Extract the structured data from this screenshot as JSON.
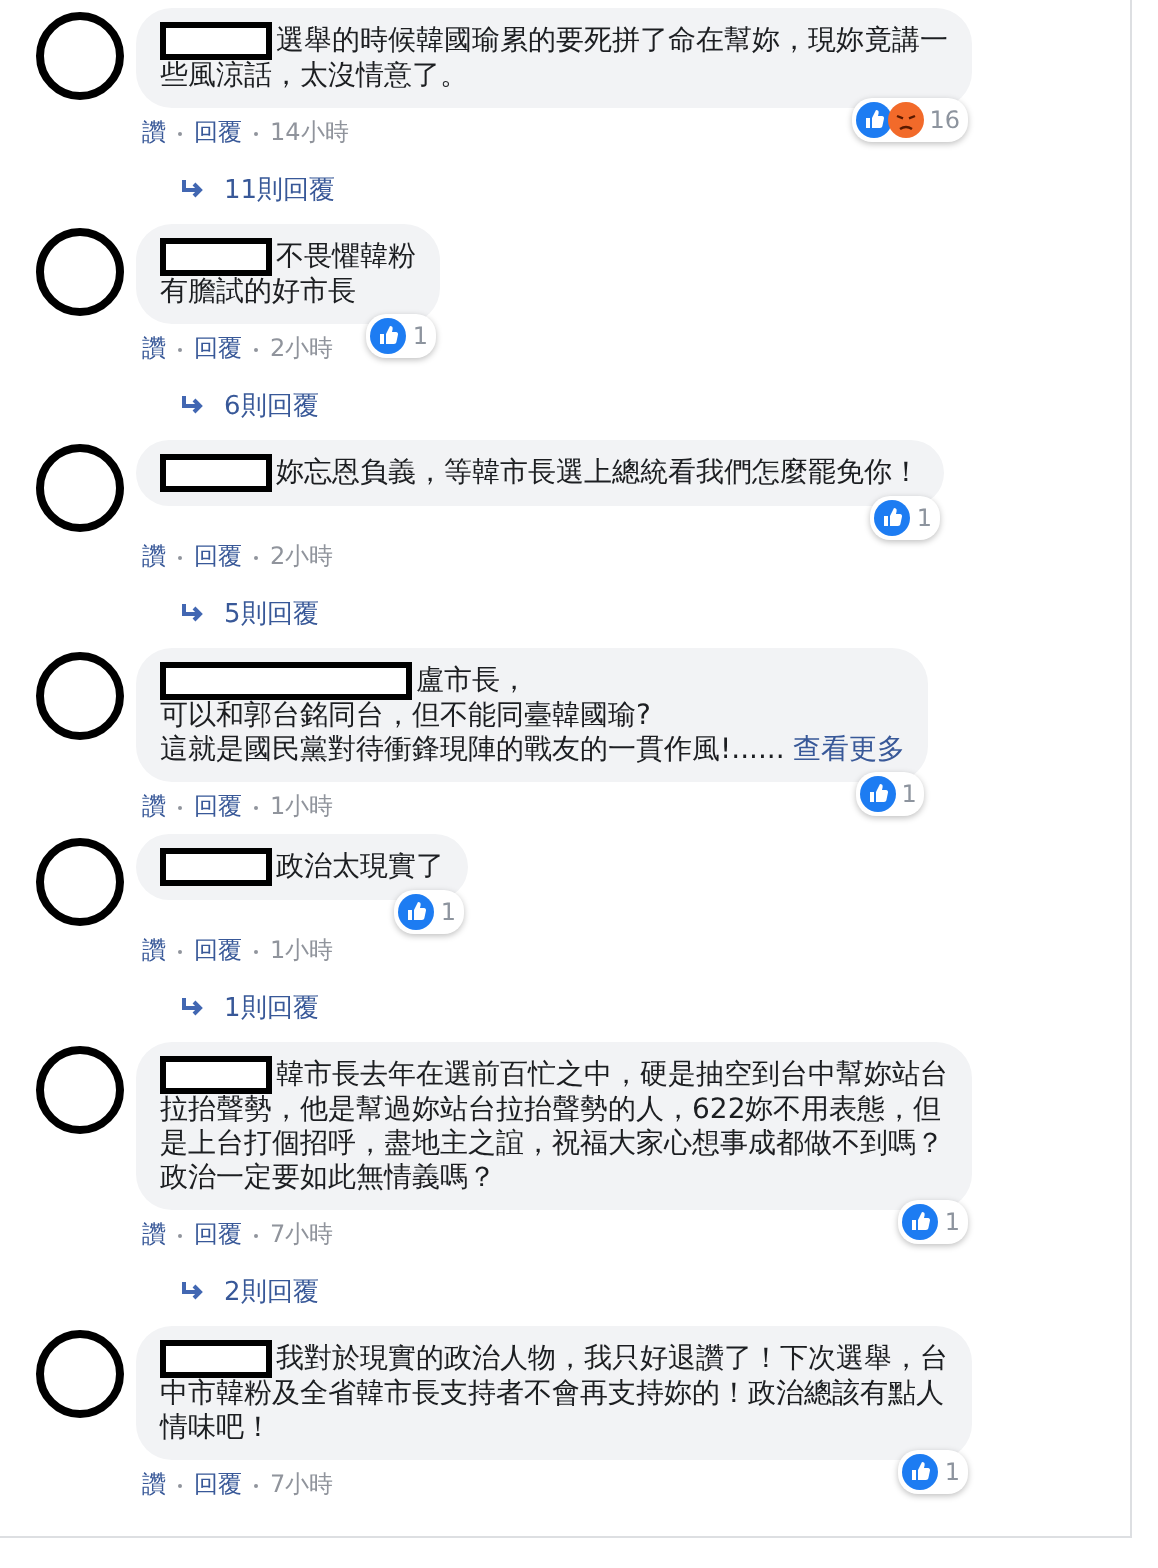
{
  "comments": [
    {
      "kind": "short_name",
      "lines": [
        "選舉的時候韓國瑜累的要死拼了命在幫妳，現妳竟講一",
        "些風涼話，太沒情意了。"
      ],
      "reactions": [
        {
          "kind": "like"
        },
        {
          "kind": "angry"
        }
      ],
      "reaction_count": "16",
      "actions": [
        "讚",
        "回覆"
      ],
      "time": "14小時",
      "replies": "11則回覆"
    },
    {
      "kind": "short_name",
      "lines": [
        "不畏懼韓粉",
        "有膽試的好市長"
      ],
      "reactions": [
        {
          "kind": "like"
        }
      ],
      "reaction_count": "1",
      "actions": [
        "讚",
        "回覆"
      ],
      "time": "2小時",
      "replies": "6則回覆"
    },
    {
      "kind": "short_name",
      "lines": [
        "妳忘恩負義，等韓市長選上總統看我們怎麼罷免你！"
      ],
      "reactions": [
        {
          "kind": "like"
        }
      ],
      "reaction_count": "1",
      "actions": [
        "讚",
        "回覆"
      ],
      "time": "2小時",
      "replies": "5則回覆"
    },
    {
      "kind": "long_name",
      "lines": [
        "盧市長，",
        "可以和郭台銘同台，但不能同臺韓國瑜?",
        "這就是國民黨對待衝鋒現陣的戰友的一貫作風!......"
      ],
      "see_more": "查看更多",
      "reactions": [
        {
          "kind": "like"
        }
      ],
      "reaction_count": "1",
      "actions": [
        "讚",
        "回覆"
      ],
      "time": "1小時"
    },
    {
      "kind": "short_name",
      "lines": [
        "政治太現實了"
      ],
      "reactions": [
        {
          "kind": "like"
        }
      ],
      "reaction_count": "1",
      "actions": [
        "讚",
        "回覆"
      ],
      "time": "1小時",
      "replies": "1則回覆"
    },
    {
      "kind": "short_name",
      "lines": [
        "韓市長去年在選前百忙之中，硬是抽空到台中幫妳站台",
        "拉抬聲勢，他是幫過妳站台拉抬聲勢的人，622妳不用表態，但",
        "是上台打個招呼，盡地主之誼，祝福大家心想事成都做不到嗎？",
        "政治一定要如此無情義嗎？"
      ],
      "reactions": [
        {
          "kind": "like"
        }
      ],
      "reaction_count": "1",
      "actions": [
        "讚",
        "回覆"
      ],
      "time": "7小時",
      "replies": "2則回覆"
    },
    {
      "kind": "short_name",
      "lines": [
        "我對於現實的政治人物，我只好退讚了！下次選舉，台",
        "中市韓粉及全省韓市長支持者不會再支持妳的！政治總該有點人",
        "情味吧！"
      ],
      "reactions": [
        {
          "kind": "like"
        }
      ],
      "reaction_count": "1",
      "actions": [
        "讚",
        "回覆"
      ],
      "time": "7小時"
    }
  ]
}
